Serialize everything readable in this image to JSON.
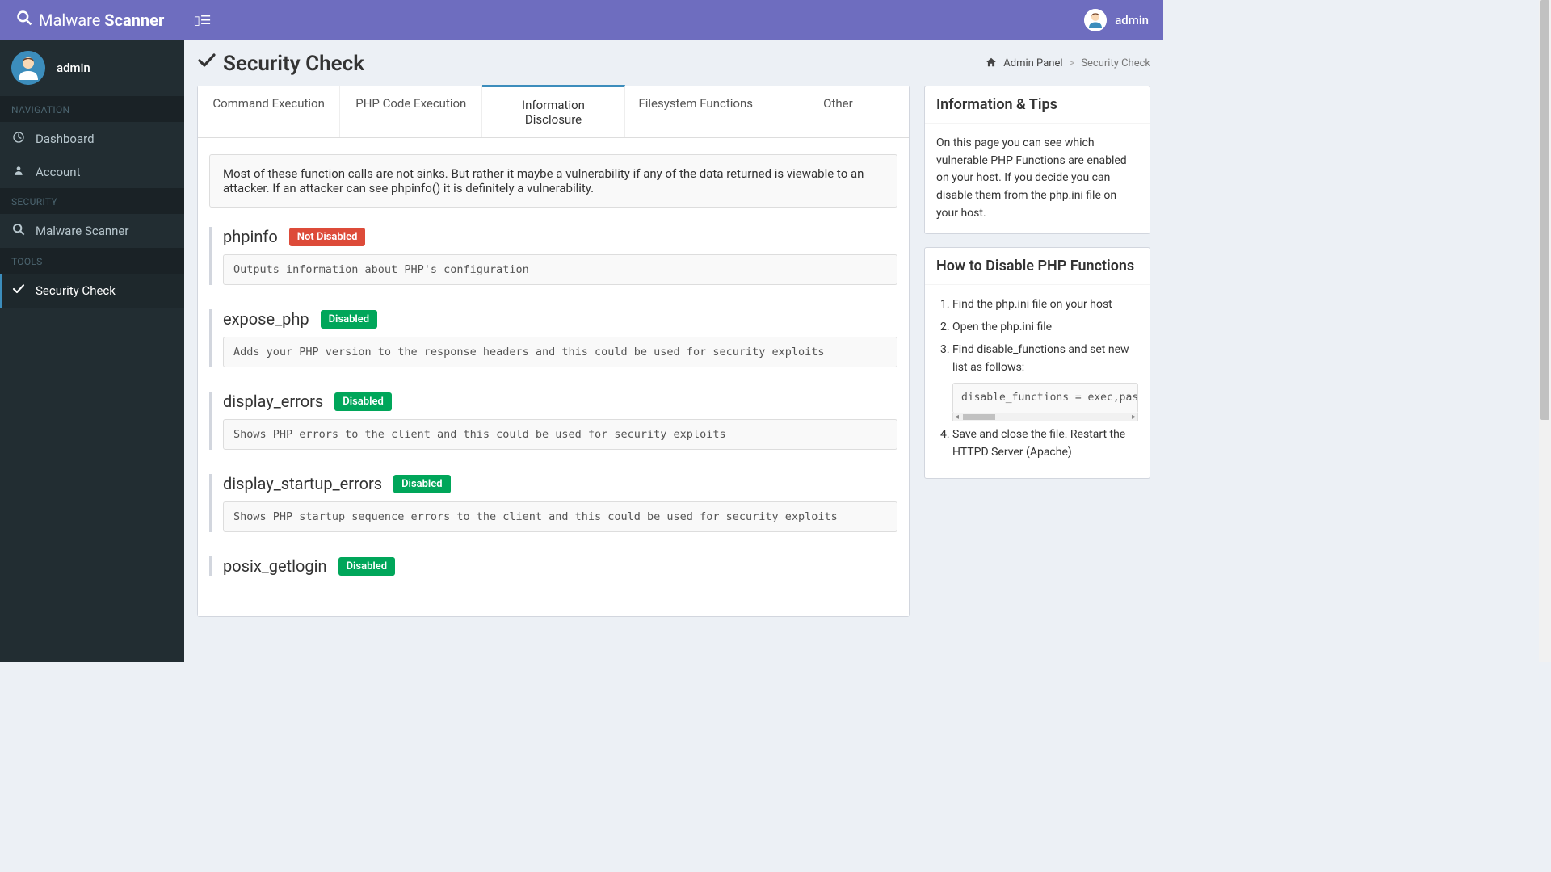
{
  "brand": {
    "icon": "search-icon",
    "part1": "Malware",
    "part2": "Scanner"
  },
  "topbar": {
    "toggle_icon": "bars-icon",
    "user": {
      "avatar": "user-avatar",
      "name": "admin"
    }
  },
  "sidebar": {
    "user": {
      "avatar": "user-avatar",
      "name": "admin"
    },
    "sections": [
      {
        "label": "NAVIGATION",
        "items": [
          {
            "icon": "dashboard-icon",
            "label": "Dashboard",
            "active": false
          },
          {
            "icon": "user-icon",
            "label": "Account",
            "active": false
          }
        ]
      },
      {
        "label": "SECURITY",
        "items": [
          {
            "icon": "search-icon",
            "label": "Malware Scanner",
            "active": false
          }
        ]
      },
      {
        "label": "TOOLS",
        "items": [
          {
            "icon": "check-icon",
            "label": "Security Check",
            "active": true
          }
        ]
      }
    ]
  },
  "page": {
    "title_icon": "check-icon",
    "title": "Security Check",
    "breadcrumb": {
      "home_icon": "home-icon",
      "home": "Admin Panel",
      "sep": ">",
      "current": "Security Check"
    }
  },
  "tabs": [
    {
      "label": "Command Execution",
      "active": false
    },
    {
      "label": "PHP Code Execution",
      "active": false
    },
    {
      "label": "Information Disclosure",
      "active": true
    },
    {
      "label": "Filesystem Functions",
      "active": false
    },
    {
      "label": "Other",
      "active": false
    }
  ],
  "tab_intro": "Most of these function calls are not sinks. But rather it maybe a vulnerability if any of the data returned is viewable to an attacker. If an attacker can see phpinfo() it is definitely a vulnerability.",
  "functions": [
    {
      "name": "phpinfo",
      "status": "Not Disabled",
      "status_color": "red",
      "desc": "Outputs information about PHP's configuration"
    },
    {
      "name": "expose_php",
      "status": "Disabled",
      "status_color": "green",
      "desc": "Adds your PHP version to the response headers and this could be used for security exploits"
    },
    {
      "name": "display_errors",
      "status": "Disabled",
      "status_color": "green",
      "desc": "Shows PHP errors to the client and this could be used for security exploits"
    },
    {
      "name": "display_startup_errors",
      "status": "Disabled",
      "status_color": "green",
      "desc": "Shows PHP startup sequence errors to the client and this could be used for security exploits"
    },
    {
      "name": "posix_getlogin",
      "status": "Disabled",
      "status_color": "green",
      "desc": ""
    }
  ],
  "info_box": {
    "title": "Information & Tips",
    "text": "On this page you can see which vulnerable PHP Functions are enabled on your host. If you decide you can disable them from the php.ini file on your host."
  },
  "howto_box": {
    "title": "How to Disable PHP Functions",
    "steps": [
      "Find the php.ini file on your host",
      "Open the php.ini file",
      "Find disable_functions and set new list as follows:",
      "Save and close the file. Restart the HTTPD Server (Apache)"
    ],
    "code": "disable_functions = exec,passthru,shell_exec,system,proc_open,popen"
  },
  "colors": {
    "primary": "#6e6dbf",
    "sidebar": "#222d32",
    "accent": "#3c8dbc",
    "red": "#dd4b39",
    "green": "#00a65a"
  }
}
